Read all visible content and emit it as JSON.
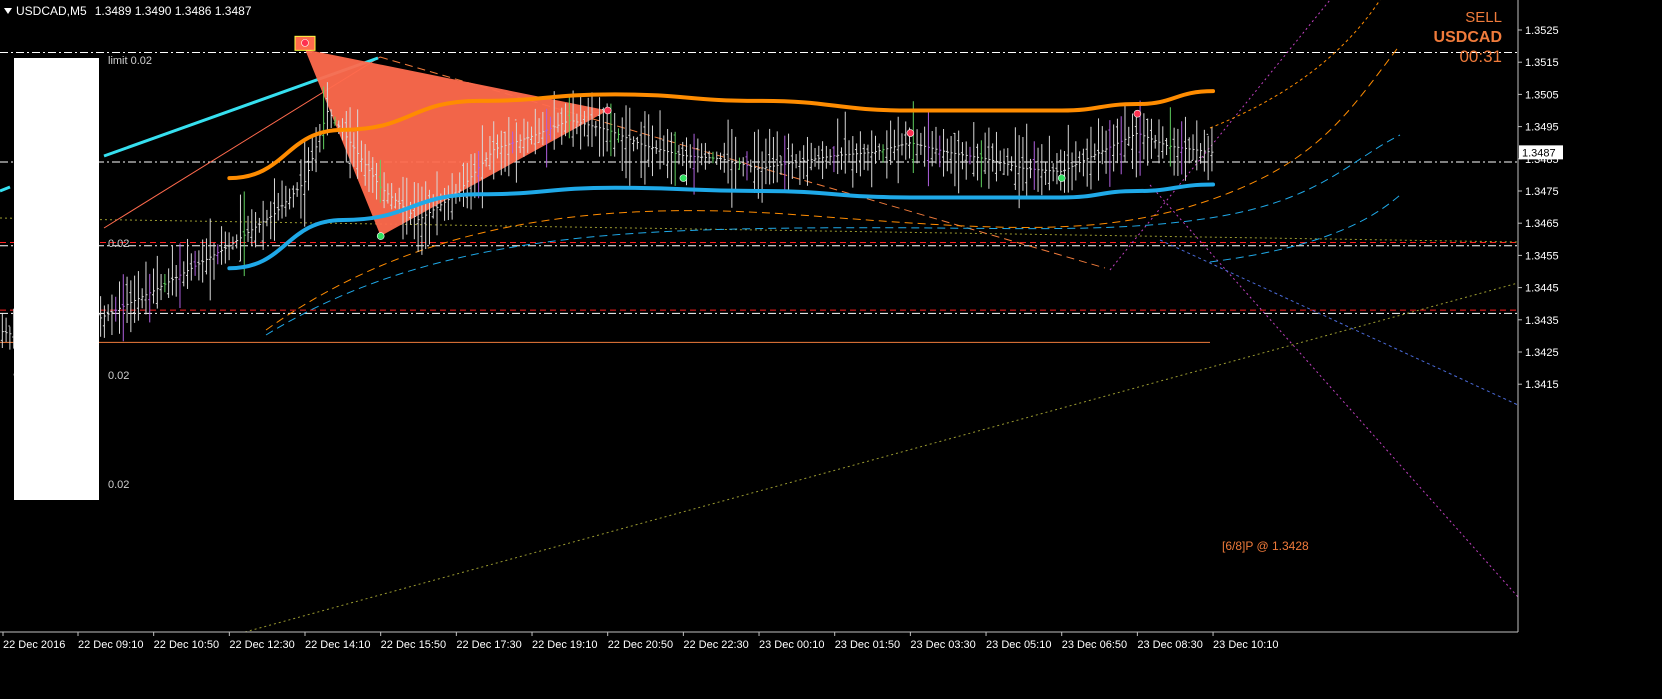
{
  "header": {
    "symbol_tf": "USDCAD,M5",
    "ohlc": "1.3489 1.3490 1.3486 1.3487"
  },
  "signal": {
    "direction": "SELL",
    "symbol": "USDCAD",
    "timer": "00:31",
    "color": "#f07b3b"
  },
  "price_axis": {
    "ticks": [
      "1.3525",
      "1.3515",
      "1.3505",
      "1.3495",
      "1.3485",
      "1.3475",
      "1.3465",
      "1.3455",
      "1.3445",
      "1.3435",
      "1.3425",
      "1.3415"
    ],
    "current": "1.3487"
  },
  "time_axis": {
    "ticks": [
      "22 Dec 2016",
      "22 Dec 09:10",
      "22 Dec 10:50",
      "22 Dec 12:30",
      "22 Dec 14:10",
      "22 Dec 15:50",
      "22 Dec 17:30",
      "22 Dec 19:10",
      "22 Dec 20:50",
      "22 Dec 22:30",
      "23 Dec 00:10",
      "23 Dec 01:50",
      "23 Dec 03:30",
      "23 Dec 05:10",
      "23 Dec 06:50",
      "23 Dec 08:30",
      "23 Dec 10:10"
    ]
  },
  "level_labels": {
    "limit": "limit 0.02",
    "l1": "0.02",
    "l2": "0.02",
    "l3": "0.02",
    "pivot": "[6/8]P @ 1.3428"
  },
  "chart_data": {
    "type": "line",
    "symbol": "USDCAD",
    "timeframe": "M5",
    "ylim": [
      1.341,
      1.3528
    ],
    "grid": false,
    "legend": "none",
    "x": [
      "22 Dec 07:20",
      "22 Dec 08:20",
      "22 Dec 09:10",
      "22 Dec 10:50",
      "22 Dec 12:30",
      "22 Dec 13:30",
      "22 Dec 14:10",
      "22 Dec 14:40",
      "22 Dec 15:10",
      "22 Dec 15:50",
      "22 Dec 16:40",
      "22 Dec 17:30",
      "22 Dec 18:20",
      "22 Dec 19:10",
      "22 Dec 20:00",
      "22 Dec 20:50",
      "22 Dec 21:40",
      "22 Dec 22:30",
      "22 Dec 23:20",
      "23 Dec 00:10",
      "23 Dec 01:00",
      "23 Dec 01:50",
      "23 Dec 02:40",
      "23 Dec 03:30",
      "23 Dec 04:20",
      "23 Dec 05:10",
      "23 Dec 06:00",
      "23 Dec 06:50",
      "23 Dec 07:40",
      "23 Dec 08:30",
      "23 Dec 09:10",
      "23 Dec 10:10"
    ],
    "series": [
      {
        "values": [
          1.3432,
          1.3428,
          1.3432,
          1.3444,
          1.3458,
          1.3468,
          1.3478,
          1.35,
          1.349,
          1.3476,
          1.3466,
          1.3474,
          1.3488,
          1.3492,
          1.3497,
          1.3494,
          1.3489,
          1.3486,
          1.3485,
          1.3482,
          1.3484,
          1.3486,
          1.3487,
          1.349,
          1.3487,
          1.3485,
          1.3482,
          1.3481,
          1.3487,
          1.3493,
          1.3489,
          1.3487
        ],
        "color": "#d0d0d0"
      }
    ],
    "harmonic_pattern": {
      "color": "#ff6a4d",
      "points": [
        {
          "time": "22 Dec 14:10",
          "price": 1.3519
        },
        {
          "time": "22 Dec 15:50",
          "price": 1.3461
        },
        {
          "time": "22 Dec 20:50",
          "price": 1.35
        }
      ]
    },
    "pivots": [
      {
        "time": "22 Dec 07:50",
        "price": 1.3418,
        "kind": "low"
      },
      {
        "time": "22 Dec 14:10",
        "price": 1.3521,
        "kind": "high"
      },
      {
        "time": "22 Dec 15:50",
        "price": 1.3461,
        "kind": "low"
      },
      {
        "time": "22 Dec 20:50",
        "price": 1.35,
        "kind": "high"
      },
      {
        "time": "22 Dec 22:30",
        "price": 1.3479,
        "kind": "low"
      },
      {
        "time": "23 Dec 03:30",
        "price": 1.3493,
        "kind": "high"
      },
      {
        "time": "23 Dec 06:50",
        "price": 1.3479,
        "kind": "low"
      },
      {
        "time": "23 Dec 08:30",
        "price": 1.3499,
        "kind": "high"
      }
    ],
    "horizontal_levels": [
      {
        "price": 1.3518,
        "style": "dash-dot",
        "color": "#ffffff"
      },
      {
        "price": 1.3484,
        "style": "dash-dot",
        "color": "#ffffff"
      },
      {
        "price": 1.3459,
        "style": "dash",
        "color": "#ff2020"
      },
      {
        "price": 1.3458,
        "style": "dash-dot",
        "color": "#ffffff"
      },
      {
        "price": 1.3438,
        "style": "dash",
        "color": "#ff2020"
      },
      {
        "price": 1.3437,
        "style": "dash-dot",
        "color": "#ffffff"
      },
      {
        "price": 1.3428,
        "style": "solid",
        "color": "#f07b3b"
      }
    ],
    "channel_upper": {
      "color": "#ff8c00",
      "times": [
        "22 Dec 12:30",
        "22 Dec 15:00",
        "22 Dec 18:00",
        "22 Dec 21:00",
        "23 Dec 00:10",
        "23 Dec 03:30",
        "23 Dec 06:50",
        "23 Dec 08:30",
        "23 Dec 10:10"
      ],
      "values": [
        1.3479,
        1.3494,
        1.3503,
        1.3505,
        1.3503,
        1.35,
        1.35,
        1.3502,
        1.3506
      ]
    },
    "channel_lower": {
      "color": "#1fa9e8",
      "times": [
        "22 Dec 12:30",
        "22 Dec 15:00",
        "22 Dec 18:00",
        "22 Dec 21:00",
        "23 Dec 00:10",
        "23 Dec 03:30",
        "23 Dec 06:50",
        "23 Dec 08:30",
        "23 Dec 10:10"
      ],
      "values": [
        1.3451,
        1.3466,
        1.3474,
        1.3476,
        1.3475,
        1.3473,
        1.3473,
        1.3475,
        1.3477
      ]
    },
    "current_price": 1.3487
  }
}
